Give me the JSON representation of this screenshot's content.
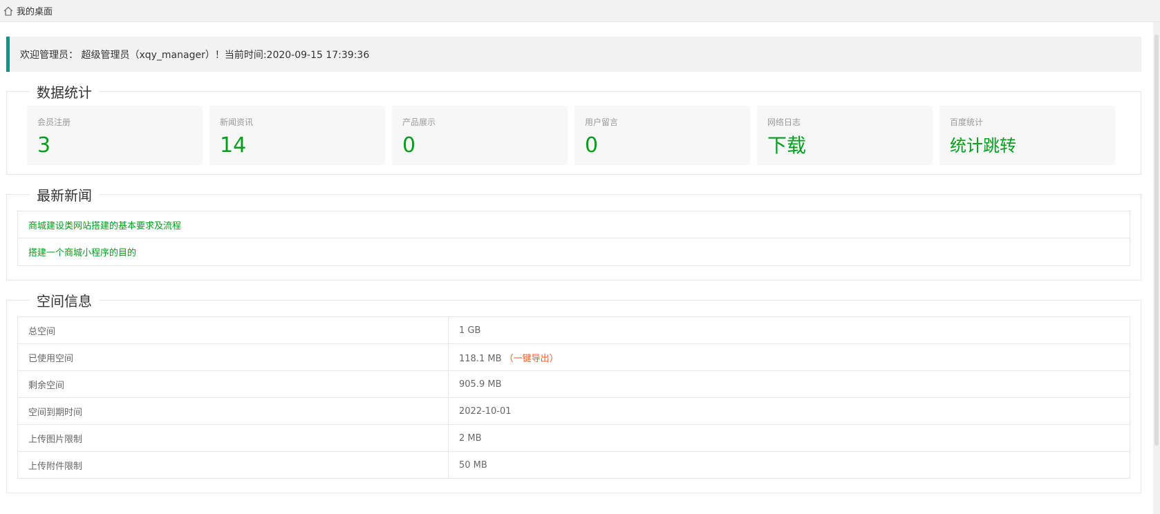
{
  "breadcrumb": {
    "home_label": "我的桌面"
  },
  "welcome": {
    "text": "欢迎管理员： 超级管理员（xqy_manager）！当前时间:2020-09-15 17:39:36"
  },
  "stats_panel": {
    "title": "数据统计",
    "cards": [
      {
        "label": "会员注册",
        "value": "3"
      },
      {
        "label": "新闻资讯",
        "value": "14"
      },
      {
        "label": "产品展示",
        "value": "0"
      },
      {
        "label": "用户留言",
        "value": "0"
      },
      {
        "label": "网络日志",
        "value": "下载"
      },
      {
        "label": "百度统计",
        "value": "统计跳转"
      }
    ]
  },
  "news_panel": {
    "title": "最新新闻",
    "items": [
      "商城建设类网站搭建的基本要求及流程",
      "搭建一个商城小程序的目的"
    ]
  },
  "space_panel": {
    "title": "空间信息",
    "rows": [
      {
        "key": "总空间",
        "value": "1 GB"
      },
      {
        "key": "已使用空间",
        "value": "118.1 MB",
        "link": "（一键导出）"
      },
      {
        "key": "剩余空间",
        "value": "905.9 MB"
      },
      {
        "key": "空间到期时间",
        "value": "2022-10-01"
      },
      {
        "key": "上传图片限制",
        "value": "2 MB"
      },
      {
        "key": "上传附件限制",
        "value": "50 MB"
      }
    ]
  },
  "colors": {
    "accent": "#009688",
    "value_green": "#009f1a",
    "link_orange": "#ff5722"
  }
}
